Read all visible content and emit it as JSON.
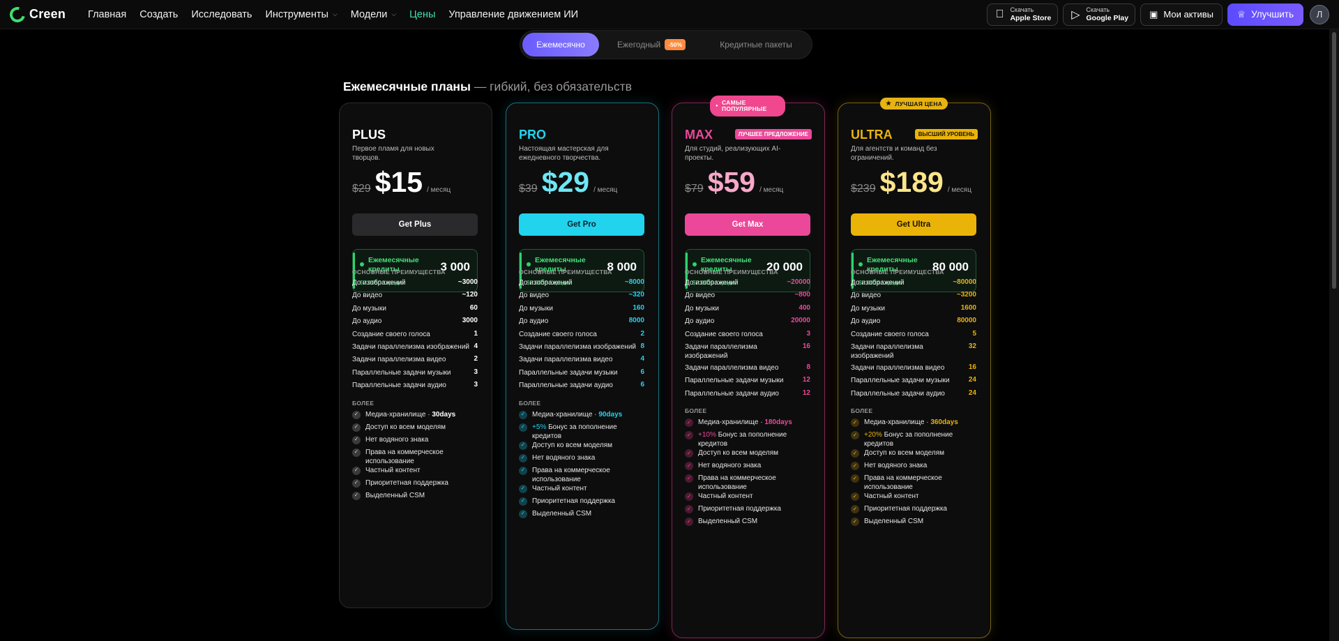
{
  "brand": {
    "name": "Creen"
  },
  "nav": [
    {
      "label": "Главная"
    },
    {
      "label": "Создать"
    },
    {
      "label": "Исследовать"
    },
    {
      "label": "Инструменты"
    },
    {
      "label": "Модели"
    },
    {
      "label": "Цены"
    },
    {
      "label": "Управление движением ИИ"
    }
  ],
  "top_actions": {
    "apple_small": "Скачать",
    "apple_big": "Apple Store",
    "google_small": "Скачать",
    "google_big": "Google Play",
    "assets": "Мои активы",
    "upgrade": "Улучшить",
    "avatar": "Л"
  },
  "billing": {
    "monthly": "Ежемесячно",
    "yearly": "Ежегодный",
    "yearly_badge": "-50%",
    "packs": "Кредитные пакеты"
  },
  "heading": {
    "bold": "Ежемесячные планы",
    "rest": " — гибкий, без обязательств"
  },
  "section_main": "ОСНОВНЫЕ ПРЕИМУЩЕСТВА",
  "section_more": "БОЛЕЕ",
  "credits_label_1": "Ежемесячные",
  "credits_label_2": "кредиты",
  "colors": {
    "plus": "#ffffff",
    "pro": "#22d3ee",
    "max": "#ec4899",
    "ultra": "#eab308",
    "green": "#2dd36f"
  },
  "plans": [
    {
      "id": "plus",
      "name": "PLUS",
      "description": "Первое пламя для новых творцов.",
      "old_price": "$29",
      "price": "$15",
      "per": "/ месяц",
      "cta": "Get Plus",
      "credits": "3 000",
      "credit_unit": "$0.0050 / кредит",
      "features": [
        {
          "label": "До изображений",
          "value": "~3000"
        },
        {
          "label": "До видео",
          "value": "~120"
        },
        {
          "label": "До музыки",
          "value": "60"
        },
        {
          "label": "До аудио",
          "value": "3000"
        },
        {
          "label": "Создание своего голоса",
          "value": "1"
        },
        {
          "label": "Задачи параллелизма изображений",
          "value": "4"
        },
        {
          "label": "Задачи параллелизма видео",
          "value": "2"
        },
        {
          "label": "Параллельные задачи музыки",
          "value": "3"
        },
        {
          "label": "Параллельные задачи аудио",
          "value": "3"
        }
      ],
      "extras": [
        {
          "text": "Медиа-хранилище · ",
          "hl": "30days"
        },
        {
          "text": "Доступ ко всем моделям"
        },
        {
          "text": "Нет водяного знака"
        },
        {
          "text": "Права на коммерческое использование"
        },
        {
          "text": "Частный контент"
        },
        {
          "text": "Приоритетная поддержка"
        },
        {
          "text": "Выделенный CSM"
        }
      ]
    },
    {
      "id": "pro",
      "name": "PRO",
      "description": "Настоящая мастерская для ежедневного творчества.",
      "old_price": "$39",
      "price": "$29",
      "per": "/ месяц",
      "cta": "Get Pro",
      "credits": "8 000",
      "credit_unit": "$0.0036 / кредит",
      "features": [
        {
          "label": "До изображений",
          "value": "~8000"
        },
        {
          "label": "До видео",
          "value": "~320"
        },
        {
          "label": "До музыки",
          "value": "160"
        },
        {
          "label": "До аудио",
          "value": "8000"
        },
        {
          "label": "Создание своего голоса",
          "value": "2"
        },
        {
          "label": "Задачи параллелизма изображений",
          "value": "8"
        },
        {
          "label": "Задачи параллелизма видео",
          "value": "4"
        },
        {
          "label": "Параллельные задачи музыки",
          "value": "6"
        },
        {
          "label": "Параллельные задачи аудио",
          "value": "6"
        }
      ],
      "extras": [
        {
          "text": "Медиа-хранилище · ",
          "hl": "90days"
        },
        {
          "hl_pre": "+5%",
          "text": " Бонус за пополнение кредитов"
        },
        {
          "text": "Доступ ко всем моделям"
        },
        {
          "text": "Нет водяного знака"
        },
        {
          "text": "Права на коммерческое использование"
        },
        {
          "text": "Частный контент"
        },
        {
          "text": "Приоритетная поддержка"
        },
        {
          "text": "Выделенный CSM"
        }
      ]
    },
    {
      "id": "max",
      "name": "MAX",
      "badge": "ЛУЧШЕЕ ПРЕДЛОЖЕНИЕ",
      "ribbon": "САМЫЕ ПОПУЛЯРНЫЕ",
      "description": "Для студий, реализующих AI-проекты.",
      "old_price": "$79",
      "price": "$59",
      "per": "/ месяц",
      "cta": "Get Max",
      "credits": "20 000",
      "credit_unit": "$0.0029 / кредит",
      "features": [
        {
          "label": "До изображений",
          "value": "~20000"
        },
        {
          "label": "До видео",
          "value": "~800"
        },
        {
          "label": "До музыки",
          "value": "400"
        },
        {
          "label": "До аудио",
          "value": "20000"
        },
        {
          "label": "Создание своего голоса",
          "value": "3"
        },
        {
          "label": "Задачи параллелизма изображений",
          "value": "16"
        },
        {
          "label": "Задачи параллелизма видео",
          "value": "8"
        },
        {
          "label": "Параллельные задачи музыки",
          "value": "12"
        },
        {
          "label": "Параллельные задачи аудио",
          "value": "12"
        }
      ],
      "extras": [
        {
          "text": "Медиа-хранилище · ",
          "hl": "180days"
        },
        {
          "hl_pre": "+10%",
          "text": " Бонус за пополнение кредитов"
        },
        {
          "text": "Доступ ко всем моделям"
        },
        {
          "text": "Нет водяного знака"
        },
        {
          "text": "Права на коммерческое использование"
        },
        {
          "text": "Частный контент"
        },
        {
          "text": "Приоритетная поддержка"
        },
        {
          "text": "Выделенный CSM"
        }
      ]
    },
    {
      "id": "ultra",
      "name": "ULTRA",
      "badge": "ВЫСШИЙ УРОВЕНЬ",
      "ribbon": "ЛУЧШАЯ ЦЕНА",
      "description": "Для агентств и команд без ограничений.",
      "old_price": "$239",
      "price": "$189",
      "per": "/ месяц",
      "cta": "Get Ultra",
      "credits": "80 000",
      "credit_unit": "$0.0024 / кредит",
      "features": [
        {
          "label": "До изображений",
          "value": "~80000"
        },
        {
          "label": "До видео",
          "value": "~3200"
        },
        {
          "label": "До музыки",
          "value": "1600"
        },
        {
          "label": "До аудио",
          "value": "80000"
        },
        {
          "label": "Создание своего голоса",
          "value": "5"
        },
        {
          "label": "Задачи параллелизма изображений",
          "value": "32"
        },
        {
          "label": "Задачи параллелизма видео",
          "value": "16"
        },
        {
          "label": "Параллельные задачи музыки",
          "value": "24"
        },
        {
          "label": "Параллельные задачи аудио",
          "value": "24"
        }
      ],
      "extras": [
        {
          "text": "Медиа-хранилище · ",
          "hl": "360days"
        },
        {
          "hl_pre": "+20%",
          "text": " Бонус за пополнение кредитов"
        },
        {
          "text": "Доступ ко всем моделям"
        },
        {
          "text": "Нет водяного знака"
        },
        {
          "text": "Права на коммерческое использование"
        },
        {
          "text": "Частный контент"
        },
        {
          "text": "Приоритетная поддержка"
        },
        {
          "text": "Выделенный CSM"
        }
      ]
    }
  ]
}
